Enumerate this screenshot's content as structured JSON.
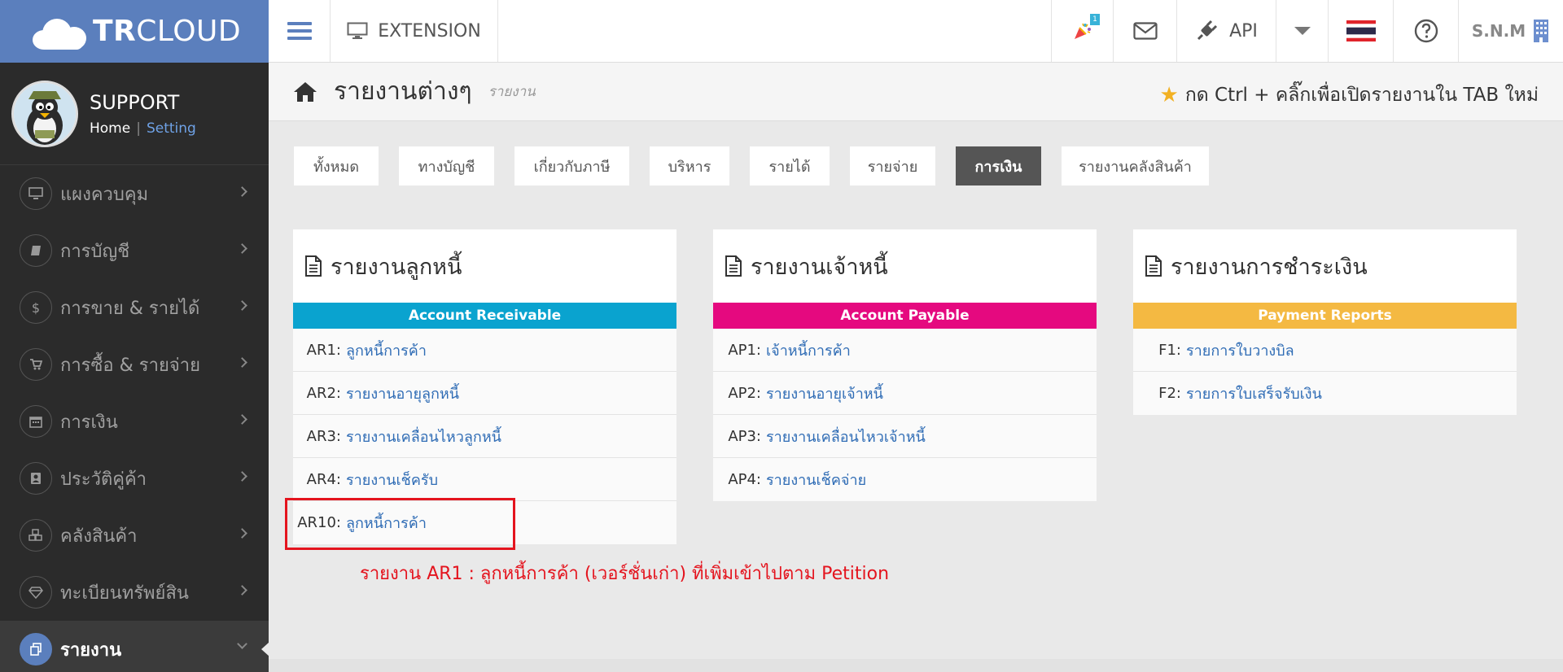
{
  "brand": {
    "name_bold": "TR",
    "name_rest": "CLOUD"
  },
  "user": {
    "name": "SUPPORT",
    "home_link": "Home",
    "separator": "|",
    "setting_link": "Setting"
  },
  "sidebar": {
    "items": [
      {
        "label": "แผงควบคุม",
        "icon": "monitor-icon"
      },
      {
        "label": "การบัญชี",
        "icon": "book-icon"
      },
      {
        "label": "การขาย & รายได้",
        "icon": "dollar-icon"
      },
      {
        "label": "การซื้อ & รายจ่าย",
        "icon": "cart-icon"
      },
      {
        "label": "การเงิน",
        "icon": "calendar-icon"
      },
      {
        "label": "ประวัติคู่ค้า",
        "icon": "contact-icon"
      },
      {
        "label": "คลังสินค้า",
        "icon": "cubes-icon"
      },
      {
        "label": "ทะเบียนทรัพย์สิน",
        "icon": "diamond-icon"
      },
      {
        "label": "รายงาน",
        "icon": "copy-icon",
        "active": true
      }
    ]
  },
  "topbar": {
    "extension_label": "EXTENSION",
    "notification_badge": "1",
    "api_label": "API",
    "company_label": "S.N.M"
  },
  "page": {
    "title": "รายงานต่างๆ",
    "subtitle": "รายงาน",
    "hint": "กด Ctrl + คลิ๊กเพื่อเปิดรายงานใน TAB ใหม่"
  },
  "tabs": [
    {
      "label": "ทั้งหมด"
    },
    {
      "label": "ทางบัญชี"
    },
    {
      "label": "เกี่ยวกับภาษี"
    },
    {
      "label": "บริหาร"
    },
    {
      "label": "รายได้"
    },
    {
      "label": "รายจ่าย"
    },
    {
      "label": "การเงิน",
      "active": true
    },
    {
      "label": "รายงานคลังสินค้า"
    }
  ],
  "panels": {
    "receivable": {
      "title": "รายงานลูกหนี้",
      "band": "Account Receivable",
      "band_color": "#0aa3cf",
      "rows": [
        {
          "code": "AR1:",
          "name": "ลูกหนี้การค้า"
        },
        {
          "code": "AR2:",
          "name": "รายงานอายุลูกหนี้"
        },
        {
          "code": "AR3:",
          "name": "รายงานเคลื่อนไหวลูกหนี้"
        },
        {
          "code": "AR4:",
          "name": "รายงานเช็ครับ"
        },
        {
          "code": "AR10:",
          "name": "ลูกหนี้การค้า"
        }
      ]
    },
    "payable": {
      "title": "รายงานเจ้าหนี้",
      "band": "Account Payable",
      "band_color": "#e5097f",
      "rows": [
        {
          "code": "AP1:",
          "name": "เจ้าหนี้การค้า"
        },
        {
          "code": "AP2:",
          "name": "รายงานอายุเจ้าหนี้"
        },
        {
          "code": "AP3:",
          "name": "รายงานเคลื่อนไหวเจ้าหนี้"
        },
        {
          "code": "AP4:",
          "name": "รายงานเช็คจ่าย"
        }
      ]
    },
    "payment": {
      "title": "รายงานการชำระเงิน",
      "band": "Payment Reports",
      "band_color": "#f4b942",
      "rows": [
        {
          "code": "F1:",
          "name": "รายการใบวางบิล"
        },
        {
          "code": "F2:",
          "name": "รายการใบเสร็จรับเงิน"
        }
      ]
    }
  },
  "annotation": {
    "note": "รายงาน AR1 : ลูกหนี้การค้า (เวอร์ชั่นเก่า) ที่เพิ่มเข้าไปตาม Petition",
    "color": "#e4141e"
  }
}
